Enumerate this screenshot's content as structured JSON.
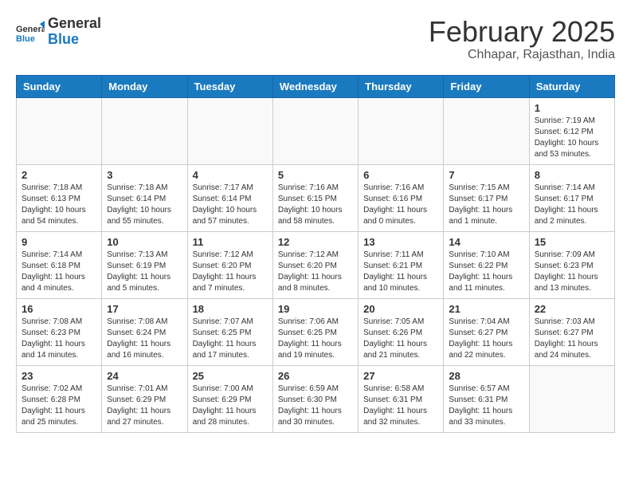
{
  "logo": {
    "general": "General",
    "blue": "Blue"
  },
  "header": {
    "month": "February 2025",
    "location": "Chhapar, Rajasthan, India"
  },
  "weekdays": [
    "Sunday",
    "Monday",
    "Tuesday",
    "Wednesday",
    "Thursday",
    "Friday",
    "Saturday"
  ],
  "weeks": [
    [
      {
        "day": "",
        "info": ""
      },
      {
        "day": "",
        "info": ""
      },
      {
        "day": "",
        "info": ""
      },
      {
        "day": "",
        "info": ""
      },
      {
        "day": "",
        "info": ""
      },
      {
        "day": "",
        "info": ""
      },
      {
        "day": "1",
        "info": "Sunrise: 7:19 AM\nSunset: 6:12 PM\nDaylight: 10 hours and 53 minutes."
      }
    ],
    [
      {
        "day": "2",
        "info": "Sunrise: 7:18 AM\nSunset: 6:13 PM\nDaylight: 10 hours and 54 minutes."
      },
      {
        "day": "3",
        "info": "Sunrise: 7:18 AM\nSunset: 6:14 PM\nDaylight: 10 hours and 55 minutes."
      },
      {
        "day": "4",
        "info": "Sunrise: 7:17 AM\nSunset: 6:14 PM\nDaylight: 10 hours and 57 minutes."
      },
      {
        "day": "5",
        "info": "Sunrise: 7:16 AM\nSunset: 6:15 PM\nDaylight: 10 hours and 58 minutes."
      },
      {
        "day": "6",
        "info": "Sunrise: 7:16 AM\nSunset: 6:16 PM\nDaylight: 11 hours and 0 minutes."
      },
      {
        "day": "7",
        "info": "Sunrise: 7:15 AM\nSunset: 6:17 PM\nDaylight: 11 hours and 1 minute."
      },
      {
        "day": "8",
        "info": "Sunrise: 7:14 AM\nSunset: 6:17 PM\nDaylight: 11 hours and 2 minutes."
      }
    ],
    [
      {
        "day": "9",
        "info": "Sunrise: 7:14 AM\nSunset: 6:18 PM\nDaylight: 11 hours and 4 minutes."
      },
      {
        "day": "10",
        "info": "Sunrise: 7:13 AM\nSunset: 6:19 PM\nDaylight: 11 hours and 5 minutes."
      },
      {
        "day": "11",
        "info": "Sunrise: 7:12 AM\nSunset: 6:20 PM\nDaylight: 11 hours and 7 minutes."
      },
      {
        "day": "12",
        "info": "Sunrise: 7:12 AM\nSunset: 6:20 PM\nDaylight: 11 hours and 8 minutes."
      },
      {
        "day": "13",
        "info": "Sunrise: 7:11 AM\nSunset: 6:21 PM\nDaylight: 11 hours and 10 minutes."
      },
      {
        "day": "14",
        "info": "Sunrise: 7:10 AM\nSunset: 6:22 PM\nDaylight: 11 hours and 11 minutes."
      },
      {
        "day": "15",
        "info": "Sunrise: 7:09 AM\nSunset: 6:23 PM\nDaylight: 11 hours and 13 minutes."
      }
    ],
    [
      {
        "day": "16",
        "info": "Sunrise: 7:08 AM\nSunset: 6:23 PM\nDaylight: 11 hours and 14 minutes."
      },
      {
        "day": "17",
        "info": "Sunrise: 7:08 AM\nSunset: 6:24 PM\nDaylight: 11 hours and 16 minutes."
      },
      {
        "day": "18",
        "info": "Sunrise: 7:07 AM\nSunset: 6:25 PM\nDaylight: 11 hours and 17 minutes."
      },
      {
        "day": "19",
        "info": "Sunrise: 7:06 AM\nSunset: 6:25 PM\nDaylight: 11 hours and 19 minutes."
      },
      {
        "day": "20",
        "info": "Sunrise: 7:05 AM\nSunset: 6:26 PM\nDaylight: 11 hours and 21 minutes."
      },
      {
        "day": "21",
        "info": "Sunrise: 7:04 AM\nSunset: 6:27 PM\nDaylight: 11 hours and 22 minutes."
      },
      {
        "day": "22",
        "info": "Sunrise: 7:03 AM\nSunset: 6:27 PM\nDaylight: 11 hours and 24 minutes."
      }
    ],
    [
      {
        "day": "23",
        "info": "Sunrise: 7:02 AM\nSunset: 6:28 PM\nDaylight: 11 hours and 25 minutes."
      },
      {
        "day": "24",
        "info": "Sunrise: 7:01 AM\nSunset: 6:29 PM\nDaylight: 11 hours and 27 minutes."
      },
      {
        "day": "25",
        "info": "Sunrise: 7:00 AM\nSunset: 6:29 PM\nDaylight: 11 hours and 28 minutes."
      },
      {
        "day": "26",
        "info": "Sunrise: 6:59 AM\nSunset: 6:30 PM\nDaylight: 11 hours and 30 minutes."
      },
      {
        "day": "27",
        "info": "Sunrise: 6:58 AM\nSunset: 6:31 PM\nDaylight: 11 hours and 32 minutes."
      },
      {
        "day": "28",
        "info": "Sunrise: 6:57 AM\nSunset: 6:31 PM\nDaylight: 11 hours and 33 minutes."
      },
      {
        "day": "",
        "info": ""
      }
    ]
  ]
}
